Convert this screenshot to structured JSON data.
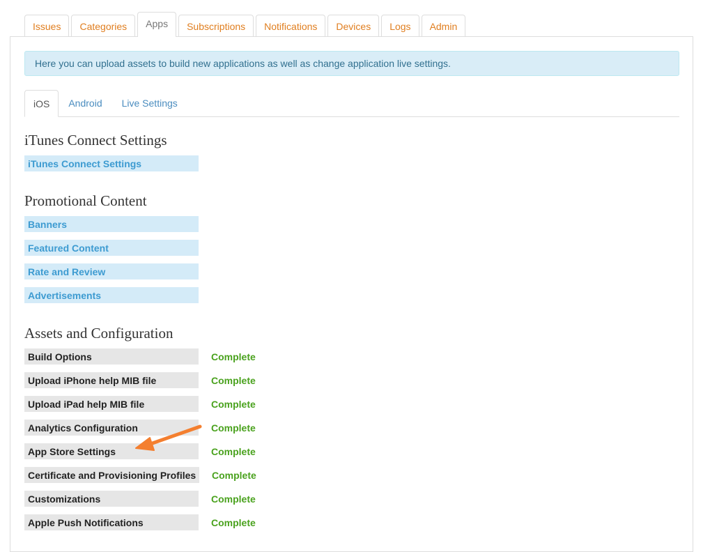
{
  "top_tabs": [
    {
      "label": "Issues",
      "active": false
    },
    {
      "label": "Categories",
      "active": false
    },
    {
      "label": "Apps",
      "active": true
    },
    {
      "label": "Subscriptions",
      "active": false
    },
    {
      "label": "Notifications",
      "active": false
    },
    {
      "label": "Devices",
      "active": false
    },
    {
      "label": "Logs",
      "active": false
    },
    {
      "label": "Admin",
      "active": false
    }
  ],
  "info_message": "Here you can upload assets to build new applications as well as change application live settings.",
  "platform_tabs": [
    {
      "label": "iOS",
      "active": true
    },
    {
      "label": "Android",
      "active": false
    },
    {
      "label": "Live Settings",
      "active": false
    }
  ],
  "itunes": {
    "title": "iTunes Connect Settings",
    "links": [
      "iTunes Connect Settings"
    ]
  },
  "promotional": {
    "title": "Promotional Content",
    "links": [
      "Banners",
      "Featured Content",
      "Rate and Review",
      "Advertisements"
    ]
  },
  "assets": {
    "title": "Assets and Configuration",
    "items": [
      {
        "label": "Build Options",
        "status": "Complete"
      },
      {
        "label": "Upload iPhone help MIB file",
        "status": "Complete"
      },
      {
        "label": "Upload iPad help MIB file",
        "status": "Complete"
      },
      {
        "label": "Analytics Configuration",
        "status": "Complete"
      },
      {
        "label": "App Store Settings",
        "status": "Complete"
      },
      {
        "label": "Certificate and Provisioning Profiles",
        "status": "Complete"
      },
      {
        "label": "Customizations",
        "status": "Complete"
      },
      {
        "label": "Apple Push Notifications",
        "status": "Complete"
      }
    ]
  },
  "colors": {
    "tab_link": "#e07e1f",
    "link_row_bg": "#d4ebf8",
    "link_text": "#3d9bd1",
    "status_complete": "#4aa21e",
    "annotation_arrow": "#f47f2f"
  },
  "annotation": {
    "icon": "arrow-annotation-icon"
  }
}
